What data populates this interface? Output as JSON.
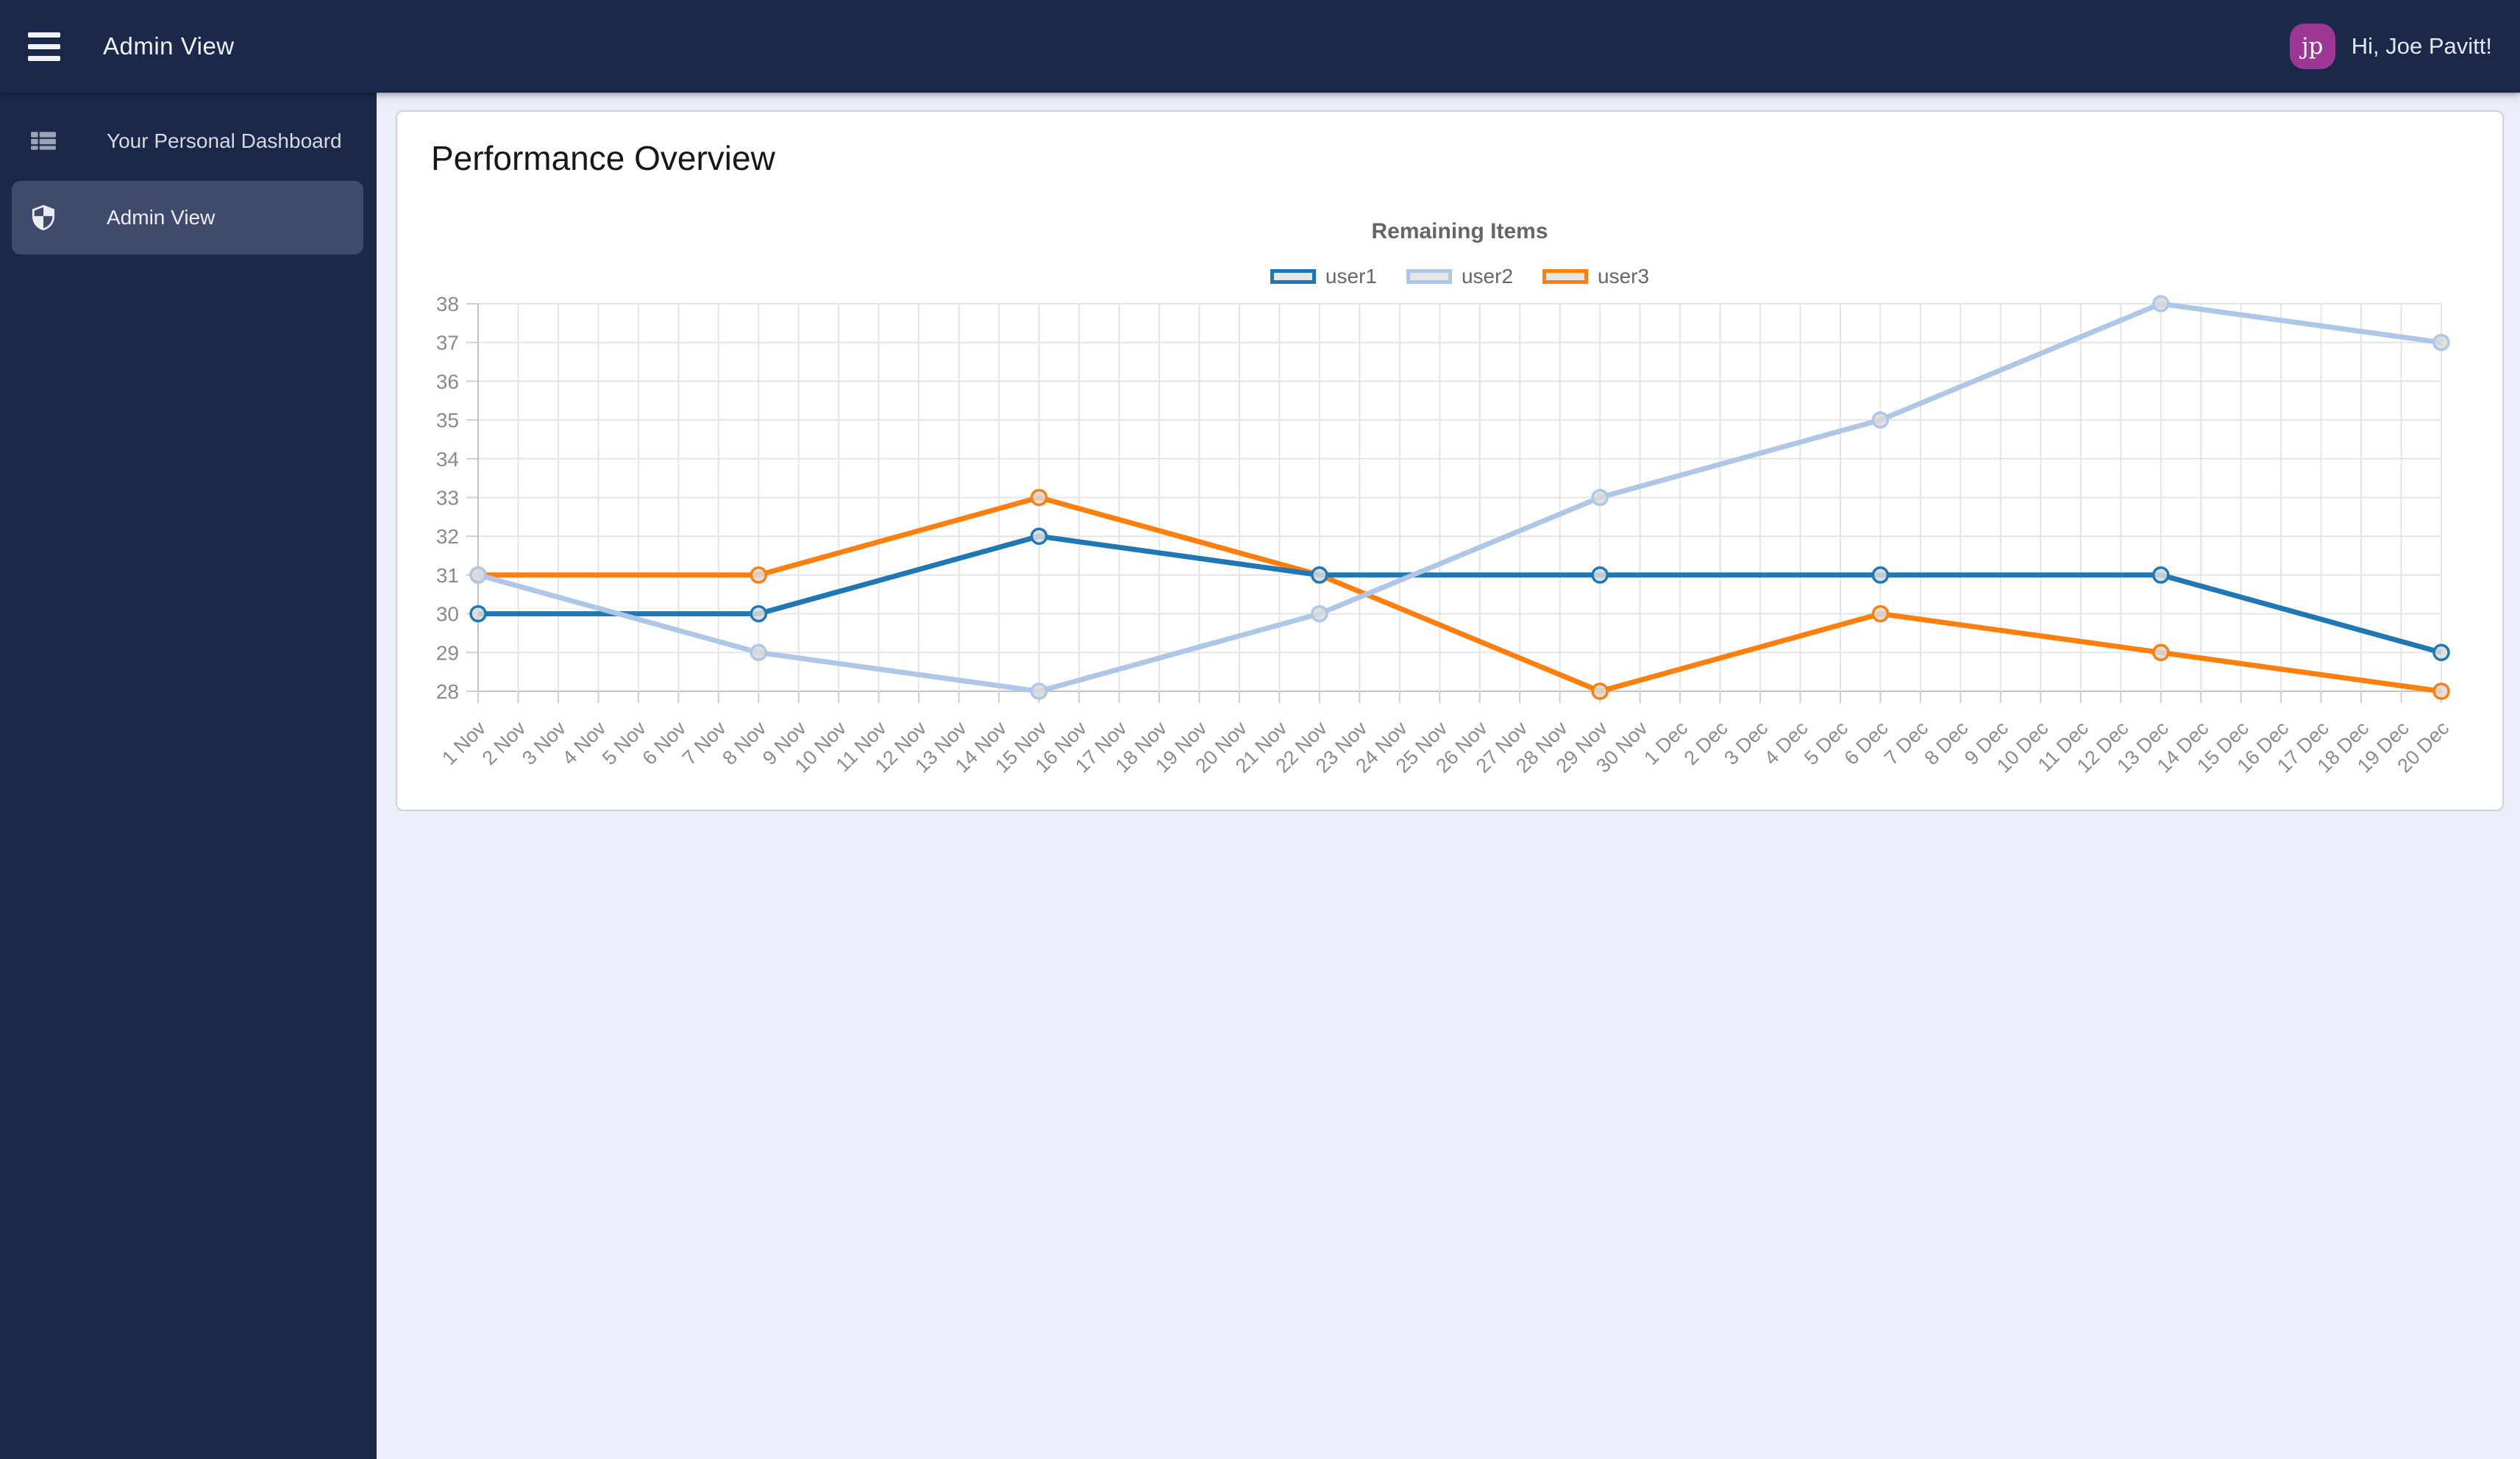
{
  "theme": {
    "navbar_bg": "#1c2849",
    "page_bg": "#e9eef8",
    "sidebar_selected_bg": "#404a6b",
    "avatar_color": "#9d3795"
  },
  "navbar": {
    "title": "Admin View",
    "avatar_initials": "jp",
    "greeting": "Hi, Joe Pavitt!"
  },
  "sidebar": {
    "items": [
      {
        "label": "Your Personal Dashboard",
        "icon": "dashboard-icon",
        "selected": false
      },
      {
        "label": "Admin View",
        "icon": "shield-icon",
        "selected": true
      }
    ]
  },
  "main": {
    "card_title": "Performance Overview"
  },
  "chart_data": {
    "type": "line",
    "title": "Remaining Items",
    "xlabel": "",
    "ylabel": "",
    "ylim": [
      28,
      38
    ],
    "y_ticks": [
      28,
      29,
      30,
      31,
      32,
      33,
      34,
      35,
      36,
      37,
      38
    ],
    "grid": true,
    "legend_position": "top",
    "x_labels": [
      "1 Nov",
      "2 Nov",
      "3 Nov",
      "4 Nov",
      "5 Nov",
      "6 Nov",
      "7 Nov",
      "8 Nov",
      "9 Nov",
      "10 Nov",
      "11 Nov",
      "12 Nov",
      "13 Nov",
      "14 Nov",
      "15 Nov",
      "16 Nov",
      "17 Nov",
      "18 Nov",
      "19 Nov",
      "20 Nov",
      "21 Nov",
      "22 Nov",
      "23 Nov",
      "24 Nov",
      "25 Nov",
      "26 Nov",
      "27 Nov",
      "28 Nov",
      "29 Nov",
      "30 Nov",
      "1 Dec",
      "2 Dec",
      "3 Dec",
      "4 Dec",
      "5 Dec",
      "6 Dec",
      "7 Dec",
      "8 Dec",
      "9 Dec",
      "10 Dec",
      "11 Dec",
      "12 Dec",
      "13 Dec",
      "14 Dec",
      "15 Dec",
      "16 Dec",
      "17 Dec",
      "18 Dec",
      "19 Dec",
      "20 Dec"
    ],
    "x_point_labels": [
      "1 Nov",
      "8 Nov",
      "15 Nov",
      "22 Nov",
      "29 Nov",
      "6 Dec",
      "13 Dec",
      "20 Dec"
    ],
    "series": [
      {
        "name": "user1",
        "color": "#1f77b4",
        "values": [
          30,
          30,
          32,
          31,
          31,
          31,
          31,
          29
        ]
      },
      {
        "name": "user2",
        "color": "#aec7e8",
        "values": [
          31,
          29,
          28,
          30,
          33,
          35,
          38,
          37
        ]
      },
      {
        "name": "user3",
        "color": "#ff7f0e",
        "values": [
          31,
          31,
          33,
          31,
          28,
          30,
          29,
          28
        ]
      }
    ]
  }
}
